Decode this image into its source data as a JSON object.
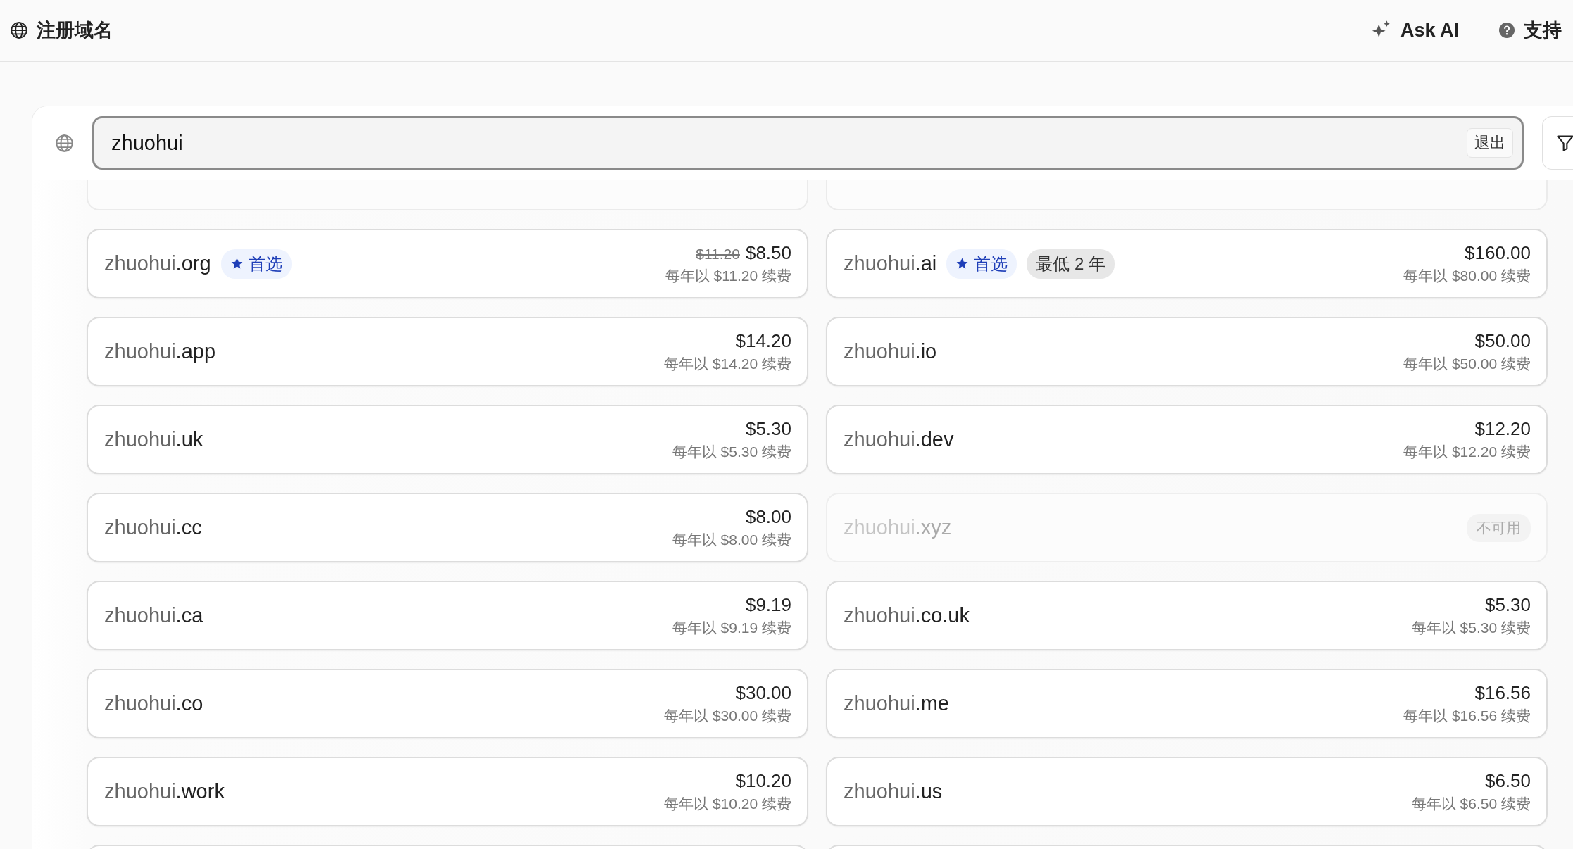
{
  "header": {
    "title": "注册域名",
    "actions": [
      {
        "kind": "ai",
        "label": "Ask AI"
      },
      {
        "kind": "help",
        "label": "支持"
      }
    ]
  },
  "search": {
    "value": "zhuohui",
    "exit_label": "退出"
  },
  "domains": [
    {
      "kind": "clipped"
    },
    {
      "kind": "clipped"
    },
    {
      "kind": "available",
      "name": "zhuohui",
      "tld": ".org",
      "tags": [
        {
          "kind": "preferred",
          "label": "首选"
        }
      ],
      "old_price": "$11.20",
      "price": "$8.50",
      "renewal": "每年以 $11.20 续费"
    },
    {
      "kind": "available",
      "name": "zhuohui",
      "tld": ".ai",
      "tags": [
        {
          "kind": "preferred",
          "label": "首选"
        },
        {
          "kind": "note",
          "label": "最低 2 年"
        }
      ],
      "price": "$160.00",
      "renewal": "每年以 $80.00 续费"
    },
    {
      "kind": "available",
      "name": "zhuohui",
      "tld": ".app",
      "price": "$14.20",
      "renewal": "每年以 $14.20 续费"
    },
    {
      "kind": "available",
      "name": "zhuohui",
      "tld": ".io",
      "price": "$50.00",
      "renewal": "每年以 $50.00 续费"
    },
    {
      "kind": "available",
      "name": "zhuohui",
      "tld": ".uk",
      "price": "$5.30",
      "renewal": "每年以 $5.30 续费"
    },
    {
      "kind": "available",
      "name": "zhuohui",
      "tld": ".dev",
      "price": "$12.20",
      "renewal": "每年以 $12.20 续费"
    },
    {
      "kind": "available",
      "name": "zhuohui",
      "tld": ".cc",
      "price": "$8.00",
      "renewal": "每年以 $8.00 续费"
    },
    {
      "kind": "unavailable",
      "name": "zhuohui",
      "tld": ".xyz",
      "status": "不可用"
    },
    {
      "kind": "available",
      "name": "zhuohui",
      "tld": ".ca",
      "price": "$9.19",
      "renewal": "每年以 $9.19 续费"
    },
    {
      "kind": "available",
      "name": "zhuohui",
      "tld": ".co.uk",
      "price": "$5.30",
      "renewal": "每年以 $5.30 续费"
    },
    {
      "kind": "available",
      "name": "zhuohui",
      "tld": ".co",
      "price": "$30.00",
      "renewal": "每年以 $30.00 续费"
    },
    {
      "kind": "available",
      "name": "zhuohui",
      "tld": ".me",
      "price": "$16.56",
      "renewal": "每年以 $16.56 续费"
    },
    {
      "kind": "available",
      "name": "zhuohui",
      "tld": ".work",
      "price": "$10.20",
      "renewal": "每年以 $10.20 续费"
    },
    {
      "kind": "available",
      "name": "zhuohui",
      "tld": ".us",
      "price": "$6.50",
      "renewal": "每年以 $6.50 续费"
    },
    {
      "kind": "clipped"
    },
    {
      "kind": "clipped"
    }
  ]
}
